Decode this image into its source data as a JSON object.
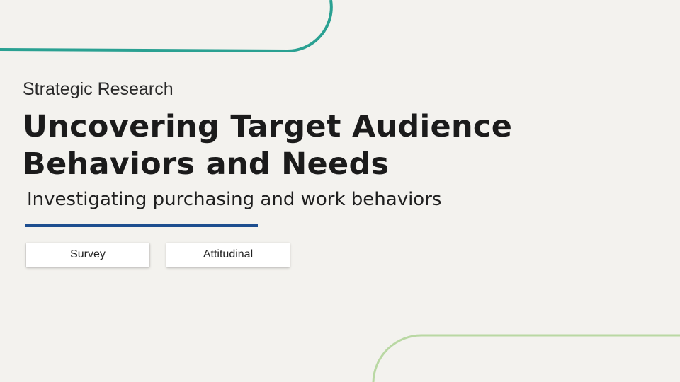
{
  "slide": {
    "eyebrow": "Strategic Research",
    "title": "Uncovering Target Audience Behaviors and Needs",
    "subtitle": "Investigating purchasing and work behaviors"
  },
  "tags": [
    {
      "label": "Survey"
    },
    {
      "label": "Attitudinal"
    }
  ],
  "colors": {
    "background": "#f3f2ee",
    "top_arc": "#2aa192",
    "bottom_arc": "#b9d8a3",
    "accent_rule": "#1d4e8f"
  }
}
